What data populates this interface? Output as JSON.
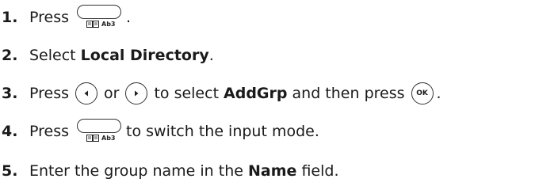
{
  "steps": [
    {
      "num": "1.",
      "pre": "Press",
      "post": "."
    },
    {
      "num": "2.",
      "pre": "Select ",
      "bold": "Local Directory",
      "post": "."
    },
    {
      "num": "3.",
      "pre": "Press",
      "or": "or",
      "mid": "to select",
      "bold": "AddGrp",
      "mid2": "and then press",
      "post": "."
    },
    {
      "num": "4.",
      "pre": "Press",
      "post": "to switch the input mode."
    },
    {
      "num": "5.",
      "pre": "Enter the group name in the ",
      "bold": "Name",
      "post": " field."
    }
  ],
  "softkey": {
    "label": "Ab3",
    "icon": "directory-book-icon"
  },
  "keys": {
    "left": "left-arrow-icon",
    "right": "right-arrow-icon",
    "ok_label": "OK"
  }
}
